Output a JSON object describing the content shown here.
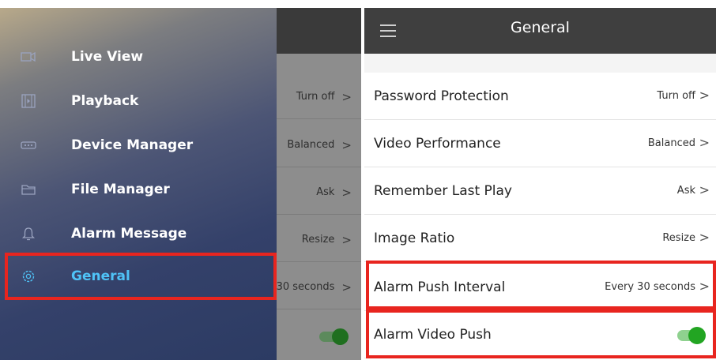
{
  "drawer": {
    "items": [
      {
        "label": "Live View",
        "icon": "video-camera-icon"
      },
      {
        "label": "Playback",
        "icon": "film-icon"
      },
      {
        "label": "Device Manager",
        "icon": "dvr-device-icon"
      },
      {
        "label": "File Manager",
        "icon": "folder-icon"
      },
      {
        "label": "Alarm Message",
        "icon": "bell-icon"
      },
      {
        "label": "General",
        "icon": "gear-icon",
        "active": true
      }
    ]
  },
  "behind_values": [
    "Turn off",
    "Balanced",
    "Ask",
    "Resize",
    "30 seconds"
  ],
  "header": {
    "title": "General"
  },
  "settings": [
    {
      "label": "Password Protection",
      "value": "Turn off"
    },
    {
      "label": "Video Performance",
      "value": "Balanced"
    },
    {
      "label": "Remember Last Play",
      "value": "Ask"
    },
    {
      "label": "Image Ratio",
      "value": "Resize"
    },
    {
      "label": "Alarm Push Interval",
      "value": "Every 30 seconds"
    },
    {
      "label": "Alarm Video Push",
      "toggle": true
    }
  ],
  "colors": {
    "highlight": "#e8251f",
    "active_item": "#4fc3f7",
    "toggle_on": "#22a522",
    "header_bg": "#3f3f3f"
  }
}
